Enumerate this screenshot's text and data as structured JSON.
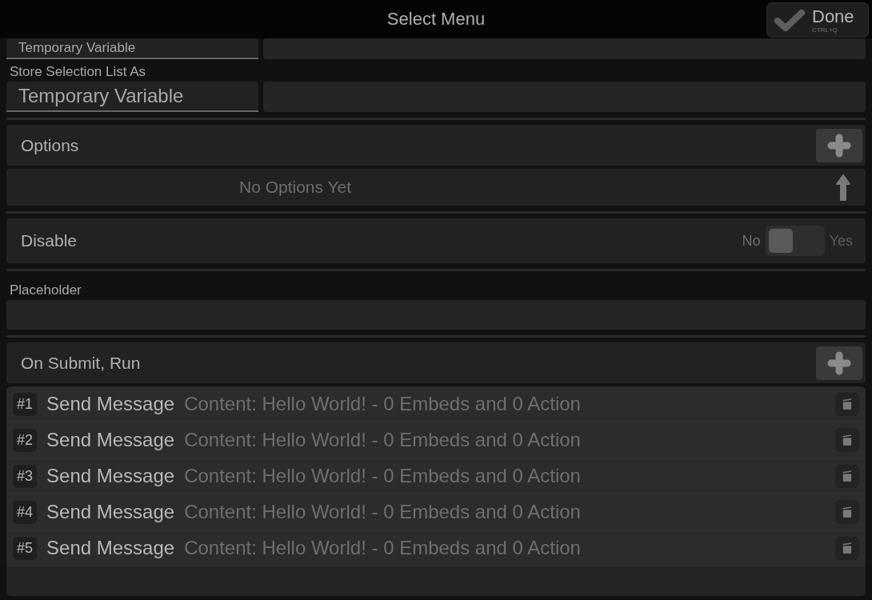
{
  "window": {
    "title": "Select Menu"
  },
  "done_button": {
    "label": "Done",
    "shortcut": "CTRL+Q"
  },
  "store_selection_cut": {
    "value": "Temporary Variable"
  },
  "store_selection": {
    "label": "Store Selection List As",
    "value": "Temporary Variable"
  },
  "options": {
    "title": "Options",
    "empty_text": "No Options Yet"
  },
  "disable": {
    "label": "Disable",
    "off_label": "No",
    "on_label": "Yes",
    "on": false
  },
  "placeholder": {
    "label": "Placeholder"
  },
  "on_submit": {
    "title": "On Submit, Run",
    "actions": [
      {
        "number": "#1",
        "name": "Send Message",
        "details": "Content: Hello World! - 0 Embeds and 0 Action"
      },
      {
        "number": "#2",
        "name": "Send Message",
        "details": "Content: Hello World! - 0 Embeds and 0 Action"
      },
      {
        "number": "#3",
        "name": "Send Message",
        "details": "Content: Hello World! - 0 Embeds and 0 Action"
      },
      {
        "number": "#4",
        "name": "Send Message",
        "details": "Content: Hello World! - 0 Embeds and 0 Action"
      },
      {
        "number": "#5",
        "name": "Send Message",
        "details": "Content: Hello World! - 0 Embeds and 0 Action"
      }
    ]
  }
}
